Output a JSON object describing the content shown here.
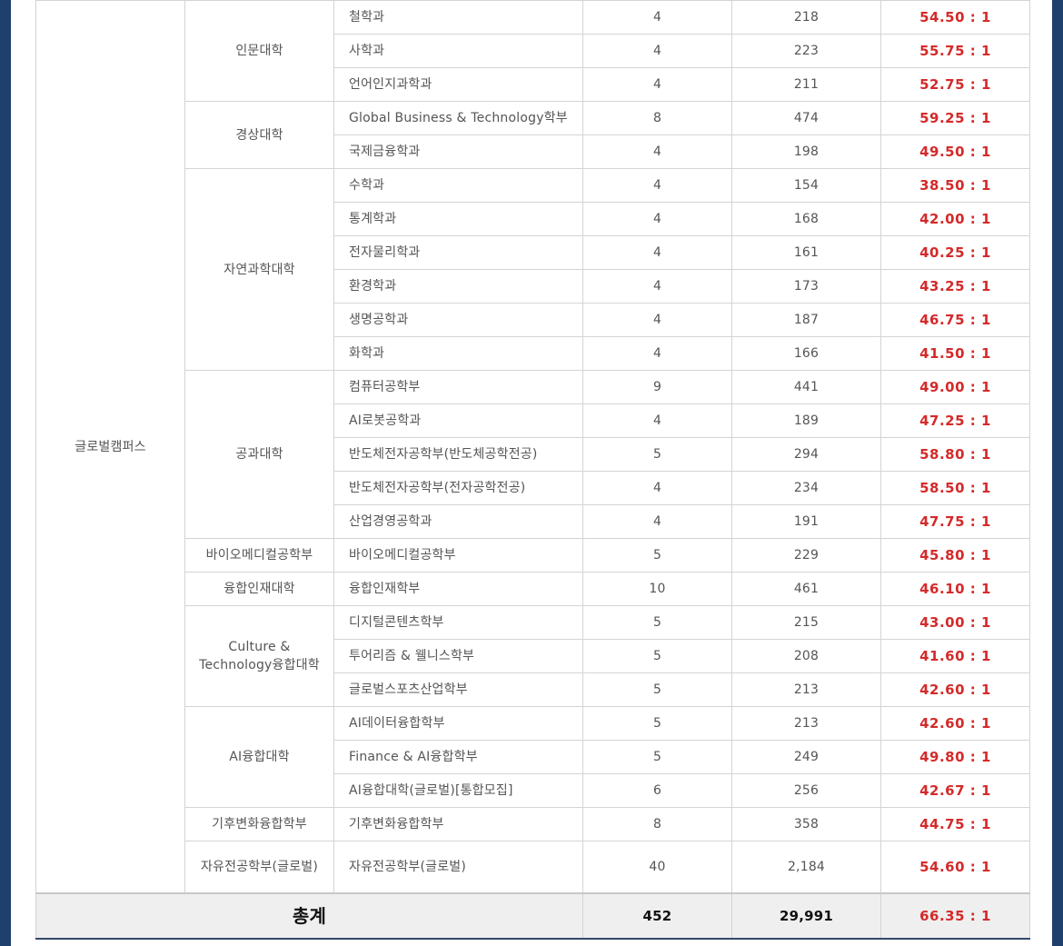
{
  "campus": "글로벌캠퍼스",
  "colleges": [
    {
      "name": "인문대학",
      "departments": [
        {
          "name": "철학과",
          "quota": "4",
          "applicants": "218",
          "ratio": "54.50 : 1"
        },
        {
          "name": "사학과",
          "quota": "4",
          "applicants": "223",
          "ratio": "55.75 : 1"
        },
        {
          "name": "언어인지과학과",
          "quota": "4",
          "applicants": "211",
          "ratio": "52.75 : 1"
        }
      ]
    },
    {
      "name": "경상대학",
      "departments": [
        {
          "name": "Global Business & Technology학부",
          "quota": "8",
          "applicants": "474",
          "ratio": "59.25 : 1"
        },
        {
          "name": "국제금융학과",
          "quota": "4",
          "applicants": "198",
          "ratio": "49.50 : 1"
        }
      ]
    },
    {
      "name": "자연과학대학",
      "departments": [
        {
          "name": "수학과",
          "quota": "4",
          "applicants": "154",
          "ratio": "38.50 : 1"
        },
        {
          "name": "통계학과",
          "quota": "4",
          "applicants": "168",
          "ratio": "42.00 : 1"
        },
        {
          "name": "전자물리학과",
          "quota": "4",
          "applicants": "161",
          "ratio": "40.25 : 1"
        },
        {
          "name": "환경학과",
          "quota": "4",
          "applicants": "173",
          "ratio": "43.25 : 1"
        },
        {
          "name": "생명공학과",
          "quota": "4",
          "applicants": "187",
          "ratio": "46.75 : 1"
        },
        {
          "name": "화학과",
          "quota": "4",
          "applicants": "166",
          "ratio": "41.50 : 1"
        }
      ]
    },
    {
      "name": "공과대학",
      "departments": [
        {
          "name": "컴퓨터공학부",
          "quota": "9",
          "applicants": "441",
          "ratio": "49.00 : 1"
        },
        {
          "name": "AI로봇공학과",
          "quota": "4",
          "applicants": "189",
          "ratio": "47.25 : 1"
        },
        {
          "name": "반도체전자공학부(반도체공학전공)",
          "quota": "5",
          "applicants": "294",
          "ratio": "58.80 : 1"
        },
        {
          "name": "반도체전자공학부(전자공학전공)",
          "quota": "4",
          "applicants": "234",
          "ratio": "58.50 : 1"
        },
        {
          "name": "산업경영공학과",
          "quota": "4",
          "applicants": "191",
          "ratio": "47.75 : 1"
        }
      ]
    },
    {
      "name": "바이오메디컬공학부",
      "departments": [
        {
          "name": "바이오메디컬공학부",
          "quota": "5",
          "applicants": "229",
          "ratio": "45.80 : 1"
        }
      ]
    },
    {
      "name": "융합인재대학",
      "departments": [
        {
          "name": "융합인재학부",
          "quota": "10",
          "applicants": "461",
          "ratio": "46.10 : 1"
        }
      ]
    },
    {
      "name": "Culture & Technology융합대학",
      "departments": [
        {
          "name": "디지털콘텐츠학부",
          "quota": "5",
          "applicants": "215",
          "ratio": "43.00 : 1"
        },
        {
          "name": "투어리즘 & 웰니스학부",
          "quota": "5",
          "applicants": "208",
          "ratio": "41.60 : 1"
        },
        {
          "name": "글로벌스포츠산업학부",
          "quota": "5",
          "applicants": "213",
          "ratio": "42.60 : 1"
        }
      ]
    },
    {
      "name": "AI융합대학",
      "departments": [
        {
          "name": "AI데이터융합학부",
          "quota": "5",
          "applicants": "213",
          "ratio": "42.60 : 1"
        },
        {
          "name": "Finance & AI융합학부",
          "quota": "5",
          "applicants": "249",
          "ratio": "49.80 : 1"
        },
        {
          "name": "AI융합대학(글로벌)[통합모집]",
          "quota": "6",
          "applicants": "256",
          "ratio": "42.67 : 1"
        }
      ]
    },
    {
      "name": "기후변화융합학부",
      "departments": [
        {
          "name": "기후변화융합학부",
          "quota": "8",
          "applicants": "358",
          "ratio": "44.75 : 1"
        }
      ]
    },
    {
      "name": "자유전공학부(글로벌)",
      "departments": [
        {
          "name": "자유전공학부(글로벌)",
          "quota": "40",
          "applicants": "2,184",
          "ratio": "54.60 : 1"
        }
      ]
    }
  ],
  "total": {
    "label": "총계",
    "quota": "452",
    "applicants": "29,991",
    "ratio": "66.35 : 1"
  }
}
